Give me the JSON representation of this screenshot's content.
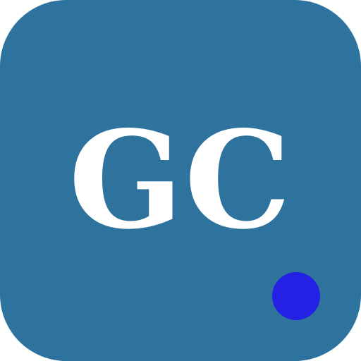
{
  "icon": {
    "monogram_text": "GC",
    "background_color": "#2d739e",
    "text_color": "#ffffff",
    "badge": {
      "icon": "notification-dot-icon",
      "color": "#2420e6"
    }
  }
}
